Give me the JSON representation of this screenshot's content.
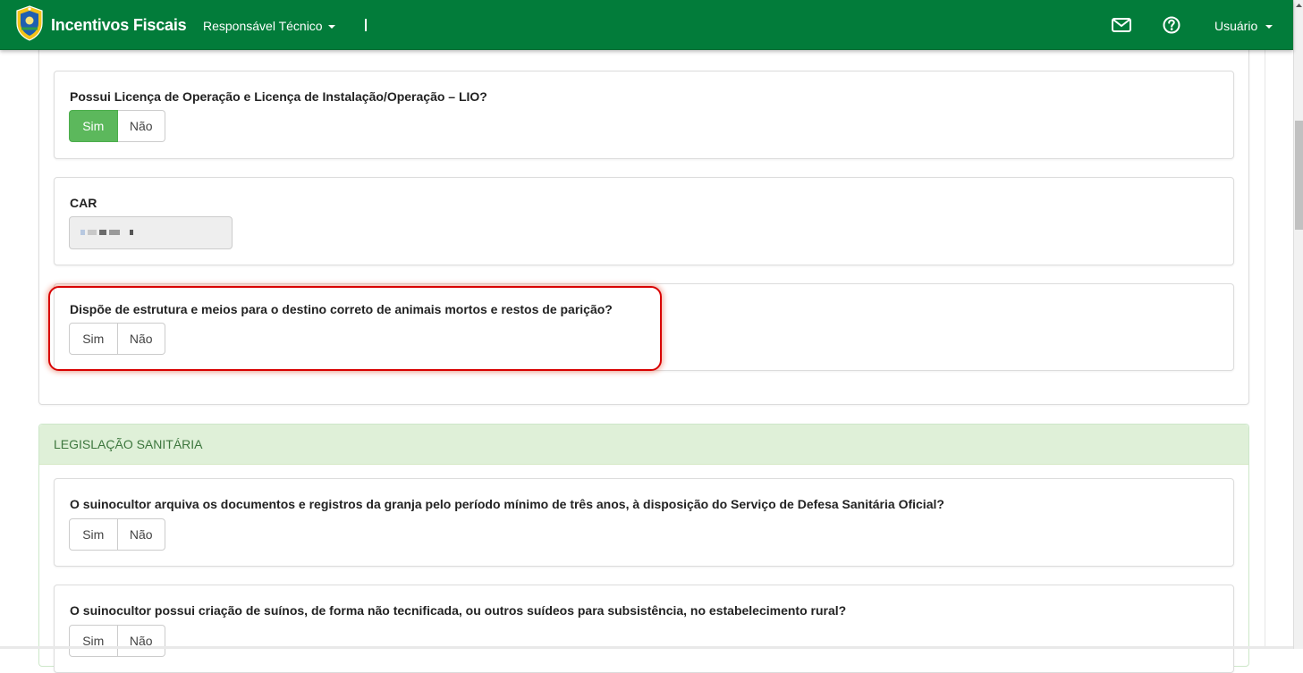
{
  "app": {
    "brand": "Incentivos Fiscais",
    "nav_role": "Responsável Técnico",
    "nav_user": "Usuário"
  },
  "questions": [
    {
      "label": "Possui Licença de Operação e Licença de Instalação/Operação – LIO?",
      "options": [
        "Sim",
        "Não"
      ],
      "selected": "Sim"
    },
    {
      "label": "Dispõe de estrutura e meios para o destino correto de animais mortos e restos de parição?",
      "options": [
        "Sim",
        "Não"
      ],
      "selected": null
    }
  ],
  "car": {
    "label": "CAR",
    "value_redacted": true
  },
  "section_legislacao": {
    "title": "LEGISLAÇÃO SANITÁRIA",
    "questions": [
      {
        "label": "O suinocultor arquiva os documentos e registros da granja pelo período mínimo de três anos, à disposição do Serviço de Defesa Sanitária Oficial?",
        "options": [
          "Sim",
          "Não"
        ],
        "selected": null
      },
      {
        "label": "O suinocultor possui criação de suínos, de forma não tecnificada, ou outros suídeos para subsistência, no estabelecimento rural?",
        "options": [
          "Sim",
          "Não"
        ],
        "selected": null
      }
    ]
  },
  "colors": {
    "navbar": "#027c3a",
    "selected_button": "#5cb85c",
    "section_header_bg": "#dff0d8",
    "section_header_text": "#3c763d",
    "highlight_border": "#d80000"
  },
  "icons": [
    "state-coat-of-arms-icon",
    "caret-down-icon",
    "envelope-icon",
    "question-circle-icon"
  ]
}
